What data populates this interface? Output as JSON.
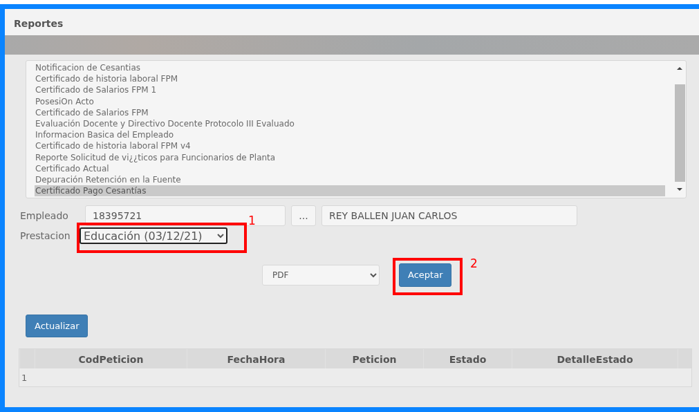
{
  "window": {
    "title": "Reportes"
  },
  "reports": [
    {
      "label": "Notificacion de Cesantias",
      "selected": false
    },
    {
      "label": "Certificado de historia laboral FPM",
      "selected": false
    },
    {
      "label": "Certificado de Salarios FPM 1",
      "selected": false
    },
    {
      "label": "PosesiOn Acto",
      "selected": false
    },
    {
      "label": "Certificado de Salarios FPM",
      "selected": false
    },
    {
      "label": "Evaluación Docente y Directivo Docente Protocolo III Evaluado",
      "selected": false
    },
    {
      "label": "Informacion Basica del Empleado",
      "selected": false
    },
    {
      "label": "Certificado de historia laboral FPM v4",
      "selected": false
    },
    {
      "label": "Reporte Solicitud de vi¿¿ticos para Funcionarios de Planta",
      "selected": false
    },
    {
      "label": "Certificado Actual",
      "selected": false
    },
    {
      "label": "Depuración Retención en la Fuente",
      "selected": false
    },
    {
      "label": "Certificado Pago Cesantías",
      "selected": true
    }
  ],
  "employee": {
    "label": "Empleado",
    "id": "18395721",
    "lookup_button": "...",
    "name": "REY BALLEN JUAN CARLOS"
  },
  "benefit": {
    "label": "Prestacion",
    "value": "Educación (03/12/21)",
    "annotation": "1"
  },
  "format": {
    "value": "PDF"
  },
  "accept_button": {
    "label": "Aceptar",
    "annotation": "2"
  },
  "refresh_button": "Actualizar",
  "table": {
    "columns": [
      "CodPeticion",
      "FechaHora",
      "Peticion",
      "Estado",
      "DetalleEstado"
    ],
    "pager": "1"
  }
}
